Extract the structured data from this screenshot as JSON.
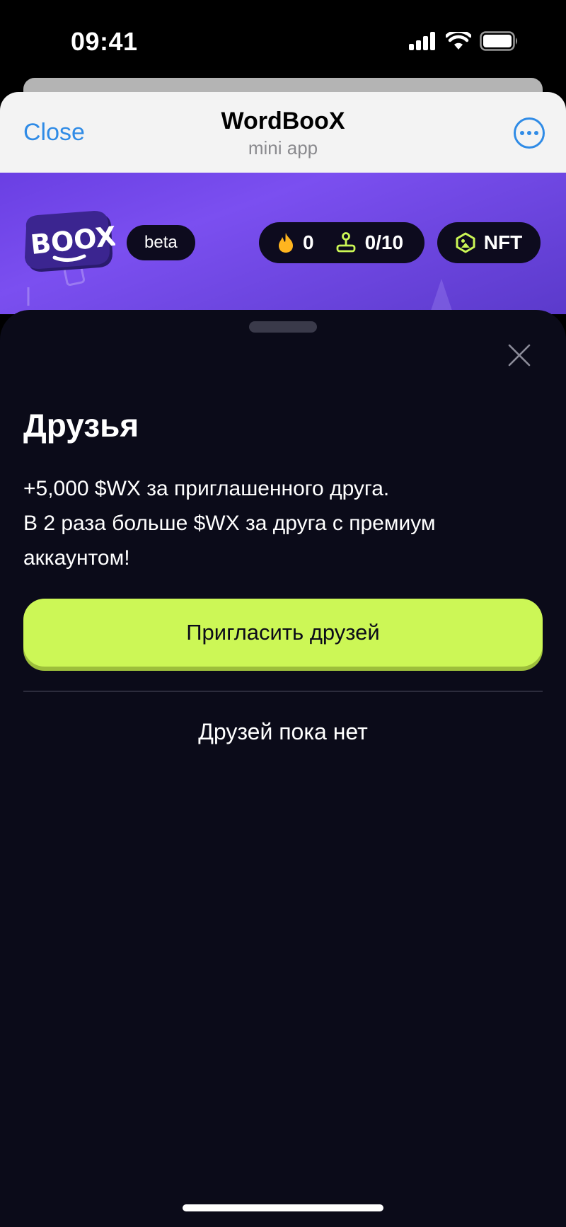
{
  "status_bar": {
    "time": "09:41",
    "icons": [
      "signal-icon",
      "wifi-icon",
      "battery-icon"
    ]
  },
  "telegram_header": {
    "close_label": "Close",
    "title": "WordBooX",
    "subtitle": "mini app",
    "more_icon": "ellipsis-icon"
  },
  "banner": {
    "logo_text": "BOOX",
    "beta_label": "beta",
    "stats": {
      "streak_value": "0",
      "energy_value": "0/10",
      "streak_icon": "fire-icon",
      "energy_icon": "joystick-icon"
    },
    "nft_label": "NFT",
    "nft_icon": "hexagon-icon"
  },
  "sheet": {
    "title": "Друзья",
    "description_lines": [
      "+5,000 $WX за приглашенного друга.",
      "В 2 раза больше $WX за друга с премиум аккаунтом!"
    ],
    "invite_button_label": "Пригласить друзей",
    "empty_state": "Друзей пока нет"
  },
  "colors": {
    "accent_green": "#ccf756",
    "banner_purple": "#7b4ff0",
    "sheet_bg": "#0b0b19",
    "link_blue": "#2f8be6",
    "fire_orange": "#ffb51f"
  }
}
